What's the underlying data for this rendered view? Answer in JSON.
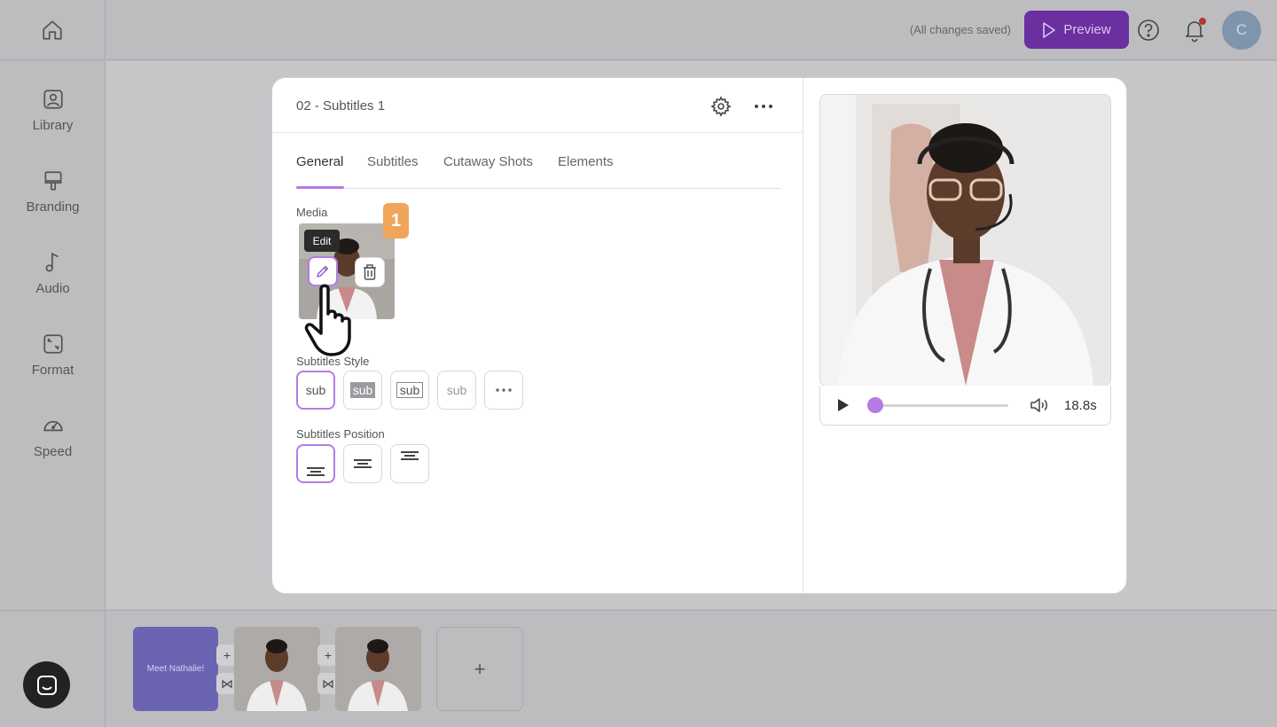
{
  "topbar": {
    "saved_status": "(All changes saved)",
    "preview_label": "Preview",
    "avatar_initial": "C"
  },
  "sidebar": {
    "items": [
      {
        "label": "Library",
        "icon": "library-icon"
      },
      {
        "label": "Branding",
        "icon": "branding-icon"
      },
      {
        "label": "Audio",
        "icon": "music-note-icon"
      },
      {
        "label": "Format",
        "icon": "format-icon"
      },
      {
        "label": "Speed",
        "icon": "speedometer-icon"
      }
    ]
  },
  "editor": {
    "title": "02 - Subtitles 1",
    "tabs": [
      {
        "label": "General",
        "active": true
      },
      {
        "label": "Subtitles",
        "active": false
      },
      {
        "label": "Cutaway Shots",
        "active": false
      },
      {
        "label": "Elements",
        "active": false
      }
    ],
    "media_label": "Media",
    "step_badge": "1",
    "tooltip": "Edit",
    "subtitles_style_label": "Subtitles Style",
    "style_options": [
      "sub",
      "sub",
      "sub",
      "sub"
    ],
    "subtitles_position_label": "Subtitles Position"
  },
  "player": {
    "duration": "18.8s",
    "progress": 0.0
  },
  "timeline": {
    "title_clip": "Meet Nathalie!"
  },
  "colors": {
    "accent": "#b67ae6",
    "preview_button": "#6b2fa0",
    "badge": "#f0a65a",
    "title_clip": "#6b64b3"
  }
}
